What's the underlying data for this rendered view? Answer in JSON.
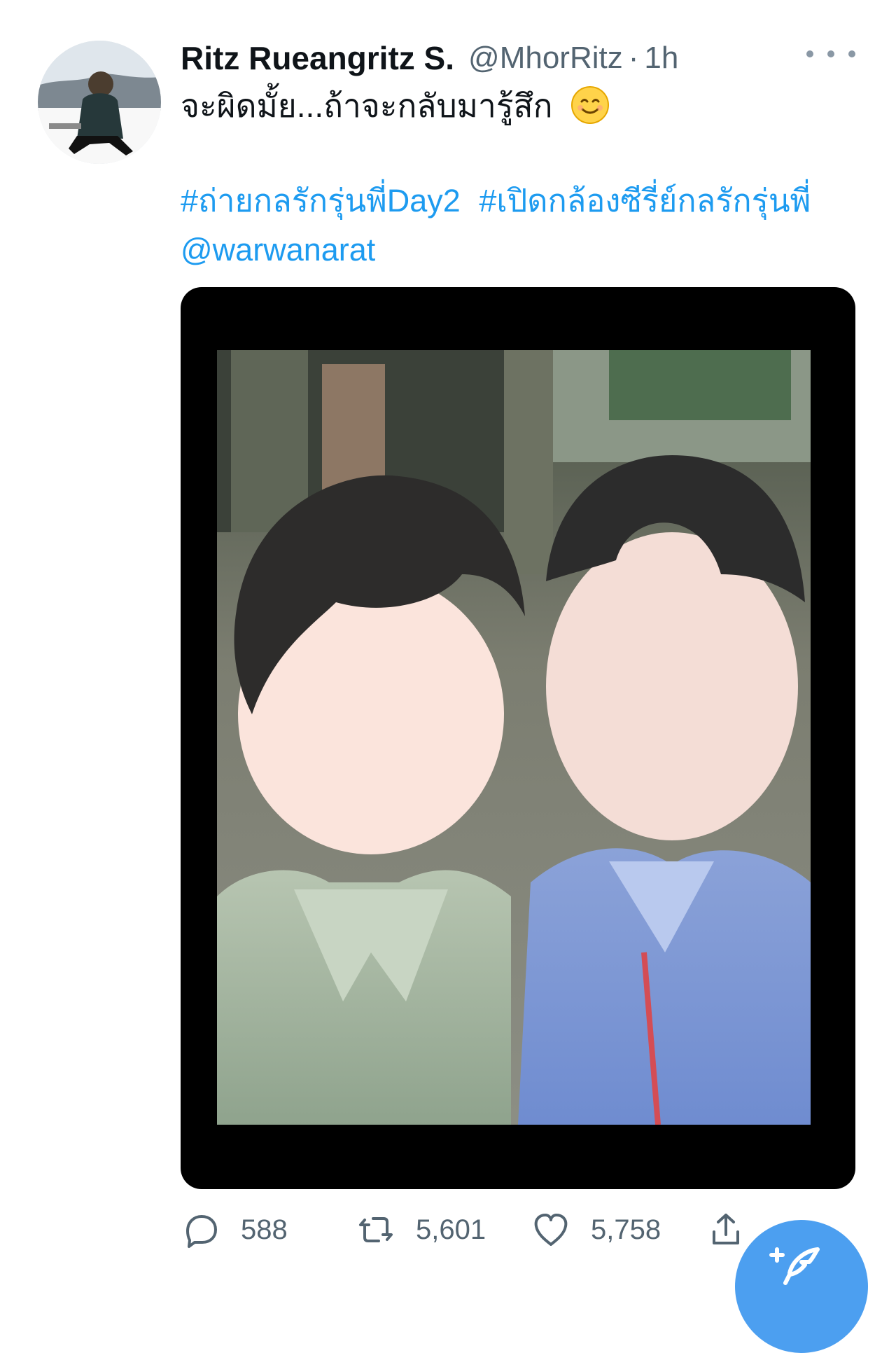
{
  "user": {
    "display_name": "Ritz Rueangritz S.",
    "handle": "@MhorRitz",
    "separator": "·",
    "time": "1h",
    "avatar_icon": "profile-photo"
  },
  "tweet": {
    "text": "จะผิดมั้ย...ถ้าจะกลับมารู้สึก",
    "emoji": "smiling-face-icon",
    "hashtags": [
      "#ถ่ายกลรักรุ่นพี่Day2",
      "#เปิดกล้องซีรี่ย์กลรักรุ่นพี่",
      "@warwanarat"
    ]
  },
  "media": {
    "description_icon": "photo-image"
  },
  "actions": {
    "reply_count": "588",
    "retweet_count": "5,601",
    "like_count": "5,758"
  },
  "icons": {
    "reply": "reply-icon",
    "retweet": "retweet-icon",
    "like": "heart-icon",
    "share": "share-icon",
    "more": "more-icon",
    "compose": "compose-icon"
  },
  "colors": {
    "accent": "#1d9bf0",
    "muted": "#536471",
    "text": "#0f1419"
  }
}
